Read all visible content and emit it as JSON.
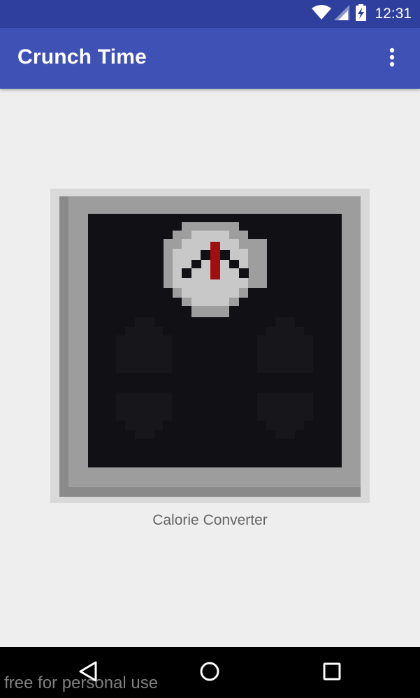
{
  "status_bar": {
    "time": "12:31",
    "icons": [
      "wifi-icon",
      "cellular-signal-icon",
      "battery-charging-icon"
    ]
  },
  "app_bar": {
    "title": "Crunch Time",
    "menu_icon": "more-vert-icon"
  },
  "main": {
    "card": {
      "image": "bathroom-scale-icon",
      "label": "Calorie Converter"
    }
  },
  "nav_bar": {
    "buttons": [
      "back-icon",
      "home-icon",
      "recents-icon"
    ]
  },
  "watermark": "free for personal use",
  "colors": {
    "status_bar": "#2f3f9e",
    "app_bar": "#3f51b5",
    "background": "#eeeeee",
    "scale_face": "#111115",
    "needle": "#a00f0f"
  }
}
